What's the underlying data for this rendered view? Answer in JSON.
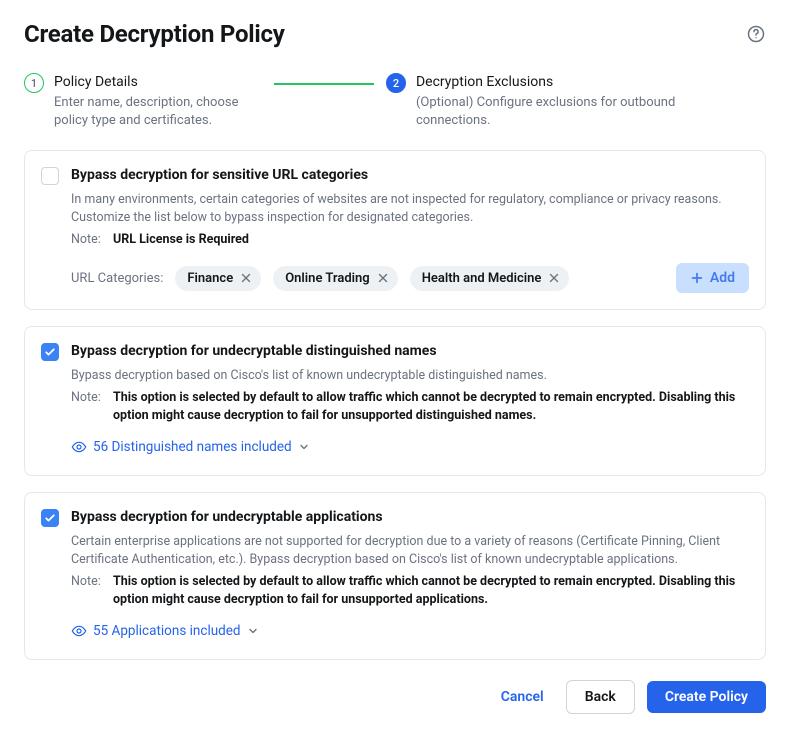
{
  "header": {
    "title": "Create Decryption Policy"
  },
  "stepper": {
    "step1": {
      "number": "1",
      "title": "Policy Details",
      "subtitle": "Enter name, description, choose policy type and certificates."
    },
    "step2": {
      "number": "2",
      "title": "Decryption Exclusions",
      "subtitle": "(Optional) Configure exclusions for outbound connections."
    }
  },
  "card_url": {
    "checked": false,
    "title": "Bypass decryption for sensitive URL categories",
    "desc": "In many environments, certain categories of websites are not inspected for regulatory, compliance or privacy reasons. Customize the list below to bypass inspection for designated categories.",
    "note_label": "Note:",
    "note_text": "URL License is Required",
    "cat_label": "URL Categories:",
    "chips": [
      "Finance",
      "Online Trading",
      "Health and Medicine"
    ],
    "add_label": "Add"
  },
  "card_dn": {
    "checked": true,
    "title": "Bypass decryption for undecryptable distinguished names",
    "desc": "Bypass decryption based on Cisco's list of known undecryptable distinguished names.",
    "note_label": "Note:",
    "note_text": "This option is selected by default to allow traffic which cannot be decrypted to remain encrypted. Disabling this option might cause decryption to fail for unsupported distinguished names.",
    "included": "56 Distinguished names included"
  },
  "card_app": {
    "checked": true,
    "title": "Bypass decryption for undecryptable applications",
    "desc": "Certain enterprise applications are not supported for decryption due to a variety of reasons (Certificate Pinning, Client Certificate Authentication, etc.). Bypass decryption based on Cisco's list of known undecryptable applications.",
    "note_label": "Note:",
    "note_text": "This option is selected by default to allow traffic which cannot be decrypted to remain encrypted. Disabling this option might cause decryption to fail for unsupported applications.",
    "included": "55 Applications included"
  },
  "footer": {
    "cancel": "Cancel",
    "back": "Back",
    "create": "Create Policy"
  }
}
